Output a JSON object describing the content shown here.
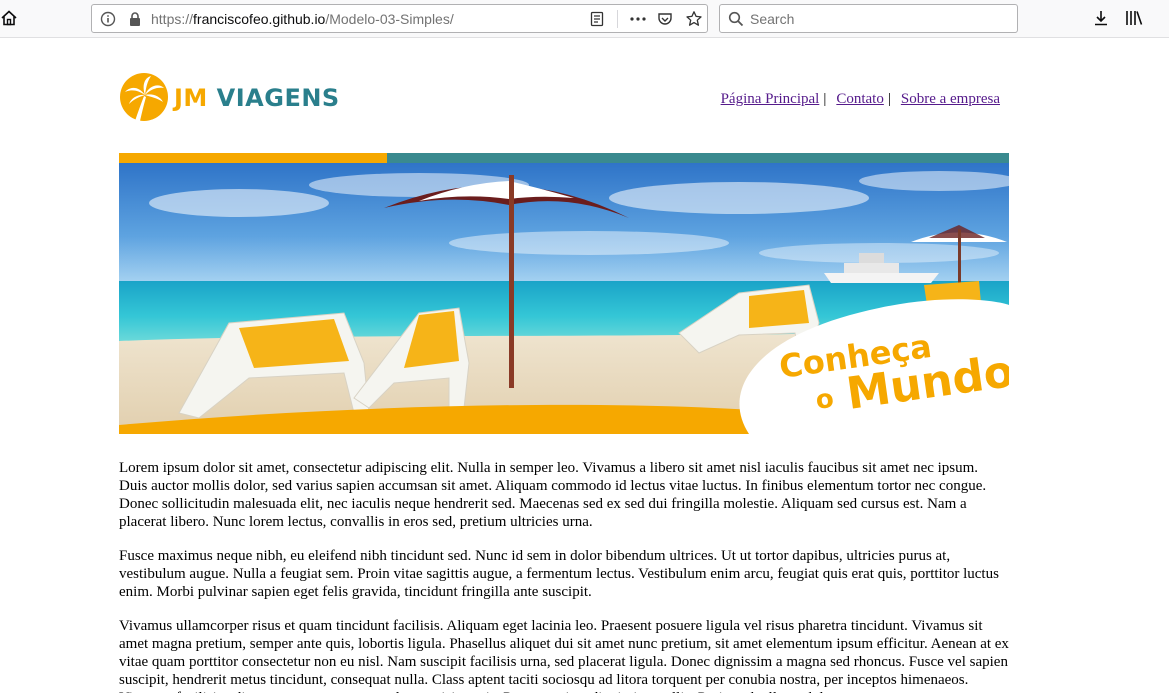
{
  "browser": {
    "url_prefix": "https://",
    "url_host": "franciscofeo.github.io",
    "url_path": "/Modelo-03-Simples/",
    "search_placeholder": "Search"
  },
  "site": {
    "logo_part1": "JM",
    "logo_part2": "VIAGENS",
    "brand_colors": {
      "orange": "#f6a800",
      "teal": "#2a7f8c"
    },
    "nav": [
      {
        "label": "Página Principal"
      },
      {
        "label": "Contato"
      },
      {
        "label": "Sobre a empresa"
      }
    ],
    "nav_separator": "|",
    "banner": {
      "slogan_line1": "Conheça",
      "slogan_line2_small": "o",
      "slogan_line2_big": "Mundo"
    },
    "paragraphs": [
      "Lorem ipsum dolor sit amet, consectetur adipiscing elit. Nulla in semper leo. Vivamus a libero sit amet nisl iaculis faucibus sit amet nec ipsum. Duis auctor mollis dolor, sed varius sapien accumsan sit amet. Aliquam commodo id lectus vitae luctus. In finibus elementum tortor nec congue. Donec sollicitudin malesuada elit, nec iaculis neque hendrerit sed. Maecenas sed ex sed dui fringilla molestie. Aliquam sed cursus est. Nam a placerat libero. Nunc lorem lectus, convallis in eros sed, pretium ultricies urna.",
      "Fusce maximus neque nibh, eu eleifend nibh tincidunt sed. Nunc id sem in dolor bibendum ultrices. Ut ut tortor dapibus, ultricies purus at, vestibulum augue. Nulla a feugiat sem. Proin vitae sagittis augue, a fermentum lectus. Vestibulum enim arcu, feugiat quis erat quis, porttitor luctus enim. Morbi pulvinar sapien eget felis gravida, tincidunt fringilla ante suscipit.",
      "Vivamus ullamcorper risus et quam tincidunt facilisis. Aliquam eget lacinia leo. Praesent posuere ligula vel risus pharetra tincidunt. Vivamus sit amet magna pretium, semper ante quis, lobortis ligula. Phasellus aliquet dui sit amet nunc pretium, sit amet elementum ipsum efficitur. Aenean at ex vitae quam porttitor consectetur non eu nisl. Nam suscipit facilisis urna, sed placerat ligula. Donec dignissim a magna sed rhoncus. Fusce vel sapien suscipit, hendrerit metus tincidunt, consequat nulla. Class aptent taciti sociosqu ad litora torquent per conubia nostra, per inceptos himenaeos. Vivamus facilisis odio non urna tempor, eu volutpat nisi mattis. Praesent vitae dignissim mollis. Proin sed tellus a dolor auctor."
    ]
  }
}
